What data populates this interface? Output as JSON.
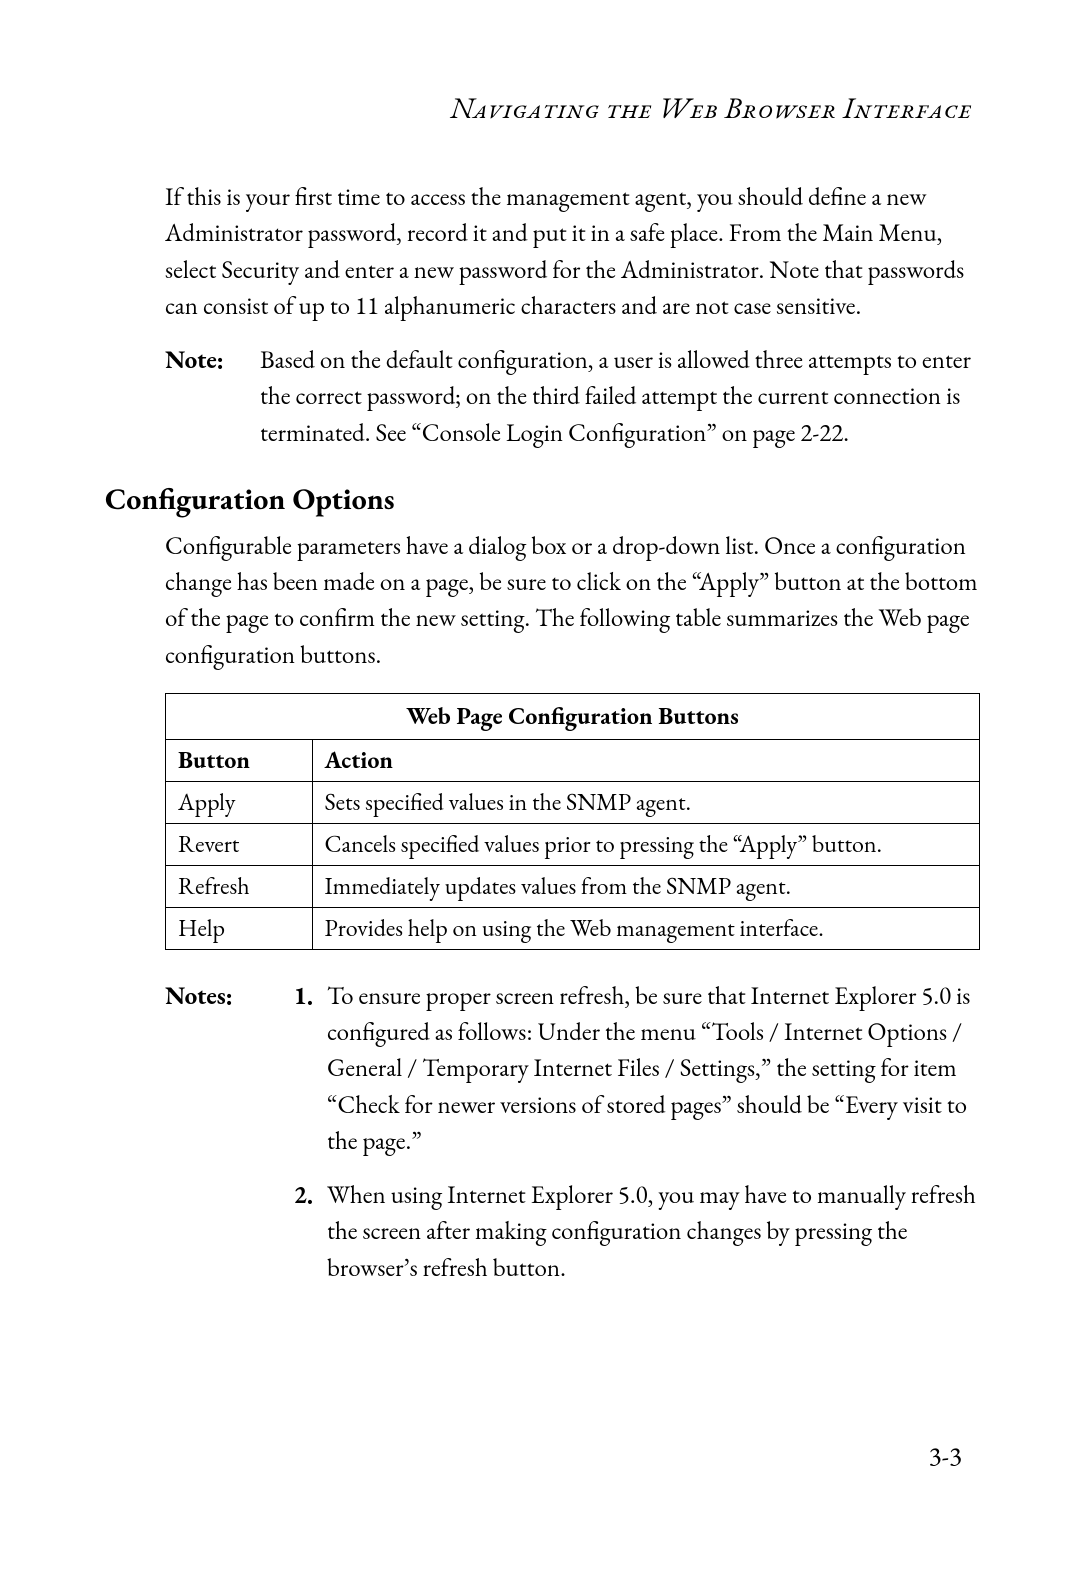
{
  "running_head": "Navigating the Web Browser Interface",
  "intro_paragraph": "If this is your first time to access the management agent, you should define a new Administrator password, record it and put it in a safe place. From the Main Menu, select Security and enter a new password for the Administrator. Note that passwords can consist of up to 11 alphanumeric characters and are not case sensitive.",
  "note1": {
    "label": "Note:",
    "body": "Based on the default configuration, a user is allowed three attempts to enter the correct password; on the third failed attempt the current connection is terminated. See “Console Login Configuration” on page 2-22."
  },
  "section_heading": "Configuration Options",
  "section_paragraph": "Configurable parameters have a dialog box or a drop-down list. Once a configuration change has been made on a page, be sure to click on the “Apply” button at the bottom of the page to confirm the new setting. The following table summarizes the Web page configuration buttons.",
  "table": {
    "caption": "Web Page Configuration Buttons",
    "headers": {
      "button": "Button",
      "action": "Action"
    },
    "rows": [
      {
        "button": "Apply",
        "action": "Sets specified values in the SNMP agent."
      },
      {
        "button": "Revert",
        "action": "Cancels specified values prior to pressing the “Apply” button."
      },
      {
        "button": "Refresh",
        "action": "Immediately updates values from the SNMP agent."
      },
      {
        "button": "Help",
        "action": "Provides help on using the Web management interface."
      }
    ]
  },
  "notes2": {
    "label": "Notes:",
    "items": [
      {
        "num": "1.",
        "text": "To ensure proper screen refresh, be sure that Internet Explorer 5.0 is configured as follows: Under the menu “Tools / Internet Options / General / Temporary Internet Files / Settings,” the setting for item “Check for newer versions of stored pages” should be “Every visit to the page.”"
      },
      {
        "num": "2.",
        "text": "When using Internet Explorer 5.0, you may have to manually refresh the screen after making configuration changes by pressing the browser’s refresh button."
      }
    ]
  },
  "page_number": "3-3"
}
